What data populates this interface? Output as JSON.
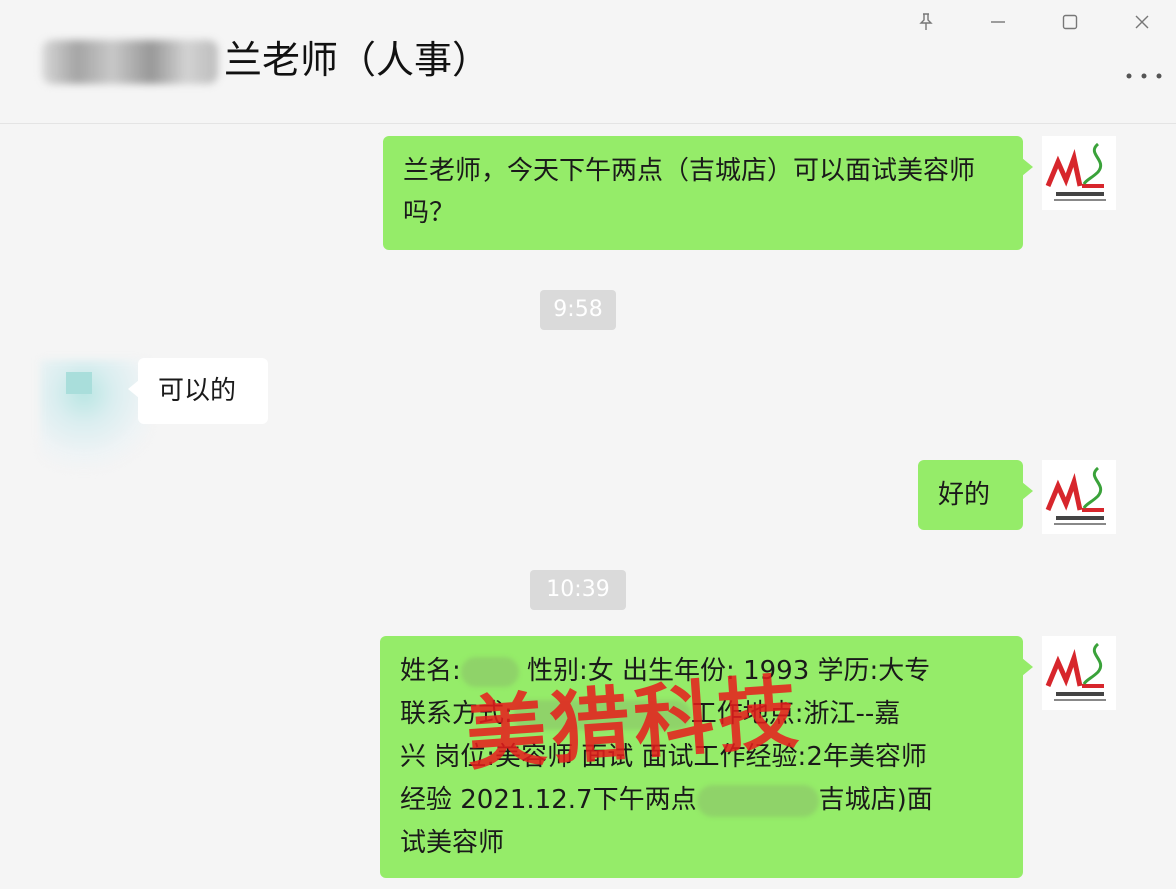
{
  "window": {
    "title": "兰老师（人事）"
  },
  "messages": [
    {
      "from": "me",
      "text": "兰老师，今天下午两点（吉城店）可以面试美容师吗？"
    },
    {
      "type": "time",
      "text": "9:58"
    },
    {
      "from": "contact",
      "text": "可以的"
    },
    {
      "from": "me",
      "text": "好的"
    },
    {
      "type": "time",
      "text": "10:39"
    },
    {
      "from": "me",
      "lines": [
        [
          "姓名:",
          "",
          " 性别:女 出生年份: 1993 学历:大专"
        ],
        [
          "联系方式:",
          "",
          "工作地点:浙江--嘉"
        ],
        [
          "兴 岗位:美容师 面试 面试工作经验:2年美容师"
        ],
        [
          "经验 2021.12.7下午两点",
          "",
          "吉城店)面"
        ],
        [
          "试美容师"
        ]
      ]
    }
  ],
  "watermark": "美猎科技",
  "colors": {
    "outgoing_bubble": "#95ec69",
    "incoming_bubble": "#ffffff",
    "background": "#f5f5f5",
    "logo_red": "#d7262c",
    "logo_green": "#3aa23a",
    "watermark": "#e81c1c"
  },
  "icons": [
    "pin-icon",
    "minimize-icon",
    "maximize-icon",
    "close-icon",
    "more-icon"
  ]
}
